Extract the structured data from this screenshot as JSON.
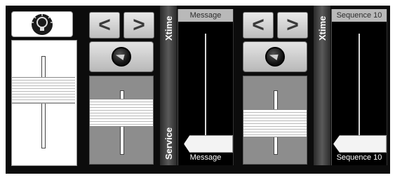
{
  "column_1": {
    "lamp_icon": "lightbulb-icon",
    "fader_level_fraction": 0.63
  },
  "column_2": {
    "prev_label": "<",
    "next_label": ">",
    "play_icon": "record-disc-icon",
    "fader_level_fraction": 0.57
  },
  "strip_1": {
    "top_label": "Xtime",
    "bottom_label": "Service"
  },
  "slider_message": {
    "header": "Message",
    "footer": "Message",
    "level_fraction": 0.0
  },
  "column_3": {
    "prev_label": "<",
    "next_label": ">",
    "play_icon": "record-disc-icon",
    "fader_level_fraction": 0.49
  },
  "strip_2": {
    "top_label": "Xtime"
  },
  "slider_sequence": {
    "header": "Sequence 10",
    "footer": "Sequence 10",
    "level_fraction": 0.0
  },
  "colors": {
    "background": "#0c0c0c",
    "fader_area": "#8d8d8d",
    "header_bg": "#b9b9b9",
    "text_light": "#ffffff"
  }
}
